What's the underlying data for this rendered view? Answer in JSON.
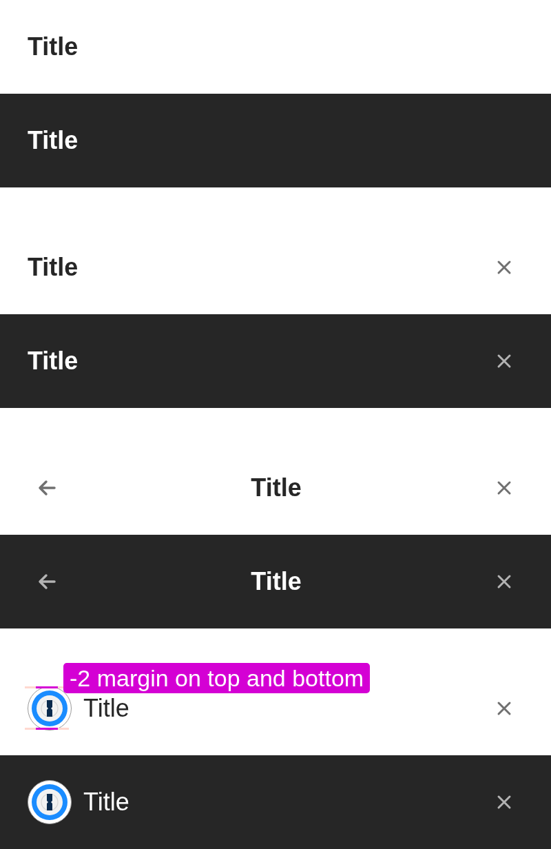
{
  "groups": [
    {
      "kind": "plain",
      "rows": [
        {
          "dark": false,
          "title": "Title"
        },
        {
          "dark": true,
          "title": "Title"
        }
      ]
    },
    {
      "kind": "close",
      "rows": [
        {
          "dark": false,
          "title": "Title"
        },
        {
          "dark": true,
          "title": "Title"
        }
      ]
    },
    {
      "kind": "back-close",
      "rows": [
        {
          "dark": false,
          "title": "Title"
        },
        {
          "dark": true,
          "title": "Title"
        }
      ]
    },
    {
      "kind": "logo-close",
      "rows": [
        {
          "dark": false,
          "title": "Title",
          "annotation": "-2 margin on top and bottom"
        },
        {
          "dark": true,
          "title": "Title"
        }
      ]
    }
  ]
}
